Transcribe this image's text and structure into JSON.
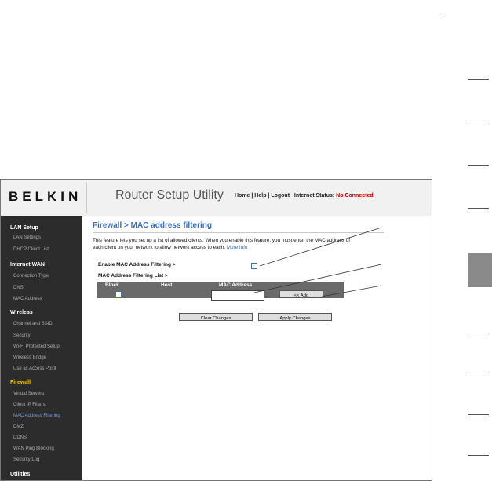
{
  "header": {
    "logo": "BELKIN",
    "app_title": "Router Setup Utility",
    "links": "Home | Help | Logout",
    "status_label": "Internet Status:",
    "status_value": "No Connected"
  },
  "sidebar": {
    "lan_setup": {
      "heading": "LAN Setup",
      "items": [
        "LAN Settings",
        "DHCP Client List"
      ]
    },
    "internet_wan": {
      "heading": "Internet WAN",
      "items": [
        "Connection Type",
        "DNS",
        "MAC Address"
      ]
    },
    "wireless": {
      "heading": "Wireless",
      "items": [
        "Channel and SSID",
        "Security",
        "Wi-Fi Protected Setup",
        "Wireless Bridge",
        "Use as Access Point"
      ]
    },
    "firewall": {
      "heading": "Firewall",
      "items": [
        "Virtual Servers",
        "Client IP Filters",
        "MAC Address Filtering",
        "DMZ",
        "DDNS",
        "WAN Ping Blocking",
        "Security Log"
      ]
    },
    "utilities": {
      "heading": "Utilities"
    }
  },
  "main": {
    "title": "Firewall > MAC address filtering",
    "description": "This feature lets you set up a list of allowed clients. When you enable this feature, you must enter the MAC address of each client on your network to allow network access to each.",
    "more_info": "More Info",
    "enable_label": "Enable MAC Address Filtering >",
    "list_label": "MAC Address Filtering List >",
    "table_headers": {
      "block": "Block",
      "host": "Host",
      "mac": "MAC Address"
    },
    "mac_input_value": "",
    "add_button": "<< Add",
    "clear_button": "Clear Changes",
    "apply_button": "Apply Changes"
  },
  "colors": {
    "accent": "#3c6fb8",
    "status": "#c00000",
    "sidebar_bg": "#2c2c2c",
    "active_heading": "#f2c200"
  }
}
